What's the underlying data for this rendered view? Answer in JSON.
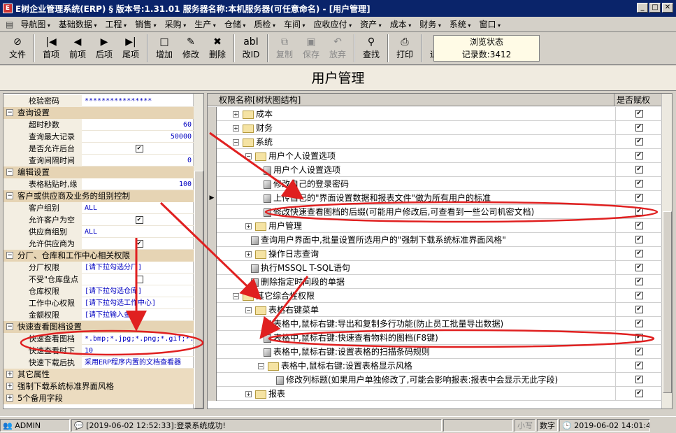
{
  "window": {
    "title": "E树企业管理系统(ERP)  § 版本号:1.31.01   服务器名称:本机服务器(可任意命名) - [用户管理]"
  },
  "menu": [
    "导航图",
    "基础数据",
    "工程",
    "销售",
    "采购",
    "生产",
    "仓储",
    "质检",
    "车间",
    "应收应付",
    "资产",
    "成本",
    "财务",
    "系统",
    "窗口"
  ],
  "toolbar": {
    "buttons": [
      {
        "label": "文件",
        "icon": "⊘",
        "enabled": true
      },
      {
        "label": "首项",
        "icon": "|◀",
        "enabled": true
      },
      {
        "label": "前项",
        "icon": "◀",
        "enabled": true
      },
      {
        "label": "后项",
        "icon": "▶",
        "enabled": true
      },
      {
        "label": "尾项",
        "icon": "▶|",
        "enabled": true
      },
      {
        "label": "增加",
        "icon": "□",
        "enabled": true
      },
      {
        "label": "修改",
        "icon": "✎",
        "enabled": true
      },
      {
        "label": "删除",
        "icon": "✖",
        "enabled": true
      },
      {
        "label": "改ID",
        "icon": "abI",
        "enabled": true
      },
      {
        "label": "复制",
        "icon": "⧉",
        "enabled": false
      },
      {
        "label": "保存",
        "icon": "▣",
        "enabled": false
      },
      {
        "label": "放弃",
        "icon": "↶",
        "enabled": false
      },
      {
        "label": "查找",
        "icon": "⚲",
        "enabled": true
      },
      {
        "label": "打印",
        "icon": "⎙",
        "enabled": true
      },
      {
        "label": "退出",
        "icon": "⇥",
        "enabled": true
      }
    ],
    "status_title": "浏览状态",
    "record_count": "记录数:3412"
  },
  "page_title": "用户管理",
  "left": {
    "rows": [
      {
        "t": "p",
        "label": "校验密码",
        "value": "****************",
        "align": "l"
      },
      {
        "t": "g",
        "label": "查询设置",
        "open": true
      },
      {
        "t": "p",
        "label": "超时秒数",
        "value": "60",
        "align": "r"
      },
      {
        "t": "p",
        "label": "查询最大记录",
        "value": "50000",
        "align": "r"
      },
      {
        "t": "p",
        "label": "是否允许后台",
        "value": "✔",
        "align": "c"
      },
      {
        "t": "p",
        "label": "查询间隔时间",
        "value": "0",
        "align": "r"
      },
      {
        "t": "g",
        "label": "编辑设置",
        "open": true
      },
      {
        "t": "p",
        "label": "表格粘贴时,缘",
        "value": "100",
        "align": "r"
      },
      {
        "t": "g",
        "label": "客户或供应商及业务的组别控制",
        "open": true
      },
      {
        "t": "p",
        "label": "客户组别",
        "value": "ALL",
        "align": "l"
      },
      {
        "t": "p",
        "label": "允许客户为空",
        "value": "✔",
        "align": "c"
      },
      {
        "t": "p",
        "label": "供应商组别",
        "value": "ALL",
        "align": "l"
      },
      {
        "t": "p",
        "label": "允许供应商为",
        "value": "✔",
        "align": "c"
      },
      {
        "t": "g",
        "label": "分厂、仓库和工作中心相关权限",
        "open": true
      },
      {
        "t": "p",
        "label": "分厂权限",
        "value": "[请下拉勾选分厂]",
        "align": "l"
      },
      {
        "t": "p",
        "label": "不受\"仓库盘点",
        "value": "□",
        "align": "c"
      },
      {
        "t": "p",
        "label": "仓库权限",
        "value": "[请下拉勾选仓库]",
        "align": "l"
      },
      {
        "t": "p",
        "label": "工作中心权限",
        "value": "[请下拉勾选工作中心]",
        "align": "l"
      },
      {
        "t": "p",
        "label": "金额权限",
        "value": "[请下拉输入金额]",
        "align": "l"
      },
      {
        "t": "g",
        "label": "快速查看图档设置",
        "open": true
      },
      {
        "t": "p",
        "label": "快速查看图档",
        "value": "*.bmp;*.jpg;*.png;*.gif;*.",
        "align": "l"
      },
      {
        "t": "p",
        "label": "快速查看时下",
        "value": "10",
        "align": "l"
      },
      {
        "t": "p",
        "label": "快速下载后执",
        "value": "采用ERP程序内置的文档查看器",
        "align": "l"
      },
      {
        "t": "g",
        "label": "其它属性",
        "open": false
      },
      {
        "t": "g",
        "label": "强制下载系统标准界面风格",
        "open": false
      },
      {
        "t": "g",
        "label": "5个备用字段",
        "open": false
      }
    ]
  },
  "right": {
    "col1": "权限名称[树状图结构]",
    "col2": "是否赋权",
    "rows": [
      {
        "lvl": 1,
        "k": "f",
        "exp": "+",
        "label": "成本",
        "chk": "✔"
      },
      {
        "lvl": 1,
        "k": "f",
        "exp": "+",
        "label": "财务",
        "chk": "✔"
      },
      {
        "lvl": 1,
        "k": "f",
        "exp": "−",
        "label": "系统",
        "chk": "✔"
      },
      {
        "lvl": 2,
        "k": "f",
        "exp": "−",
        "label": "用户个人设置选项",
        "chk": "✔"
      },
      {
        "lvl": 3,
        "k": "l",
        "label": "用户个人设置选项",
        "chk": "✔"
      },
      {
        "lvl": 3,
        "k": "l",
        "label": "修改自己的登录密码",
        "chk": "✔"
      },
      {
        "lvl": 3,
        "k": "l",
        "label": "上传自己的\"界面设置数据和报表文件\"做为所有用户的标准",
        "chk": "✔",
        "cur": true
      },
      {
        "lvl": 3,
        "k": "l",
        "label": "修改快速查看图档的后缀(可能用户修改后,可查看到一些公司机密文档)",
        "chk": "✔"
      },
      {
        "lvl": 2,
        "k": "f",
        "exp": "+",
        "label": "用户管理",
        "chk": "✔"
      },
      {
        "lvl": 2,
        "k": "l",
        "label": "查询用户界面中,批量设置所选用户的\"强制下载系统标准界面风格\"",
        "chk": "✔"
      },
      {
        "lvl": 2,
        "k": "f",
        "exp": "+",
        "label": "操作日志查询",
        "chk": "✔"
      },
      {
        "lvl": 2,
        "k": "l",
        "label": "执行MSSQL T-SQL语句",
        "chk": "✔"
      },
      {
        "lvl": 2,
        "k": "l",
        "label": "删除指定时间段的单据",
        "chk": "✔"
      },
      {
        "lvl": 1,
        "k": "f",
        "exp": "−",
        "label": "其它综合性权限",
        "chk": "✔"
      },
      {
        "lvl": 2,
        "k": "f",
        "exp": "−",
        "label": "表格右键菜单",
        "chk": "✔"
      },
      {
        "lvl": 3,
        "k": "l",
        "label": "表格中,鼠标右键:导出和复制多行功能(防止员工批量导出数据)",
        "chk": "✔"
      },
      {
        "lvl": 3,
        "k": "l",
        "label": "表格中,鼠标右键:快速查看物料的图档(F8键)",
        "chk": "✔"
      },
      {
        "lvl": 3,
        "k": "l",
        "label": "表格中,鼠标右键:设置表格的扫描条码规则",
        "chk": "✔"
      },
      {
        "lvl": 3,
        "k": "f",
        "exp": "−",
        "label": "表格中,鼠标右键:设置表格显示风格",
        "chk": "✔"
      },
      {
        "lvl": 4,
        "k": "l",
        "label": "修改列标题(如果用户单独修改了,可能会影响报表:报表中会显示无此字段)",
        "chk": "✔"
      },
      {
        "lvl": 2,
        "k": "f",
        "exp": "+",
        "label": "报表",
        "chk": "✔"
      }
    ]
  },
  "statusbar": {
    "user": "ADMIN",
    "message": "[2019-06-02 12:52:33]:登录系统成功!",
    "caps": "小写",
    "num": "数字",
    "time": "2019-06-02 14:01:4"
  },
  "colors": {
    "annotation": "#e02020",
    "title_bg": "#0a246a",
    "group_bg": "#e6d4b4"
  }
}
